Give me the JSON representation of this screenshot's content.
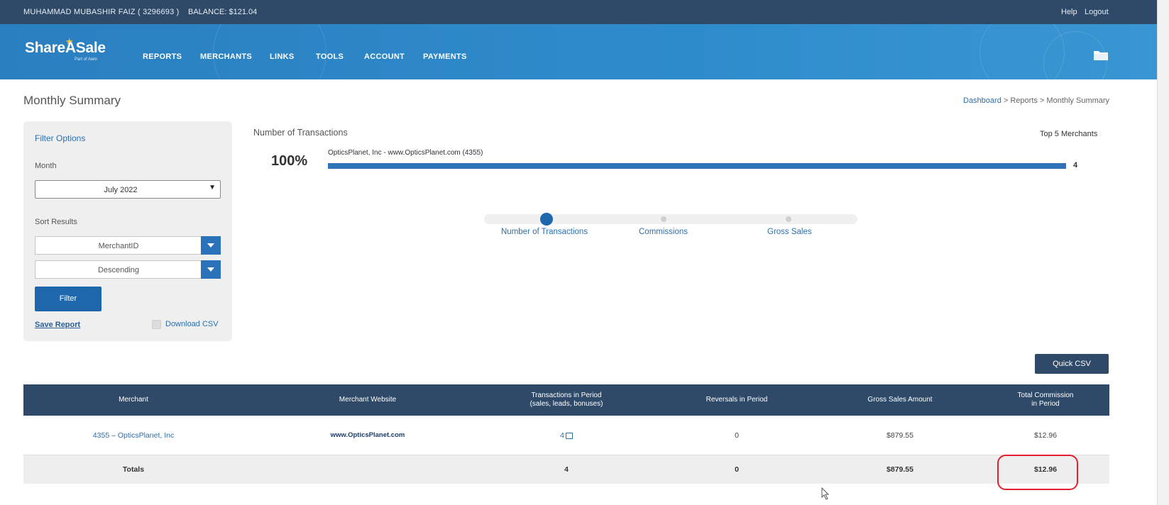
{
  "topbar": {
    "user": "MUHAMMAD MUBASHIR FAIZ ( 3296693 )",
    "balance": "BALANCE: $121.04",
    "help": "Help",
    "logout": "Logout"
  },
  "brand": {
    "logo": "ShareASale",
    "sub": "Part of Awin"
  },
  "nav": {
    "items": [
      "REPORTS",
      "MERCHANTS",
      "LINKS",
      "TOOLS",
      "ACCOUNT",
      "PAYMENTS"
    ]
  },
  "page": {
    "title": "Monthly Summary",
    "breadcrumb": {
      "dashboard": "Dashboard",
      "sep1": " > Reports > Monthly Summary"
    }
  },
  "filter": {
    "title": "Filter Options",
    "month_label": "Month",
    "month_value": "July 2022",
    "sort_label": "Sort Results",
    "sort_field": "MerchantID",
    "sort_order": "Descending",
    "filter_button": "Filter",
    "save_report": "Save Report",
    "download_csv": "Download CSV"
  },
  "chart": {
    "title": "Number of Transactions",
    "top5": "Top 5 Merchants",
    "percent": "100%",
    "merchant": "OpticsPlanet, Inc - www.OpticsPlanet.com (4355)",
    "count": "4",
    "fill_fraction": 1.0,
    "slider_labels": [
      "Number of Transactions",
      "Commissions",
      "Gross Sales"
    ],
    "slider_selected": "Number of Transactions"
  },
  "quick_csv": "Quick CSV",
  "table": {
    "headers": {
      "merchant": "Merchant",
      "website": "Merchant Website",
      "transactions_1": "Transactions in Period",
      "transactions_2": "(sales, leads, bonuses)",
      "reversals": "Reversals in Period",
      "gross": "Gross Sales Amount",
      "commission_1": "Total Commission",
      "commission_2": "in Period"
    },
    "row": {
      "merchant": "4355 – OpticsPlanet, Inc",
      "website": "www.OpticsPlanet.com",
      "transactions": "4",
      "reversals": "0",
      "gross": "$879.55",
      "commission": "$12.96"
    },
    "totals": {
      "label": "Totals",
      "transactions": "4",
      "reversals": "0",
      "gross": "$879.55",
      "commission": "$12.96"
    }
  },
  "colors": {
    "topbar": "#2f4a68",
    "nav": "#2f8ccc",
    "accent": "#1f67ad",
    "highlight": "#e0202e"
  }
}
